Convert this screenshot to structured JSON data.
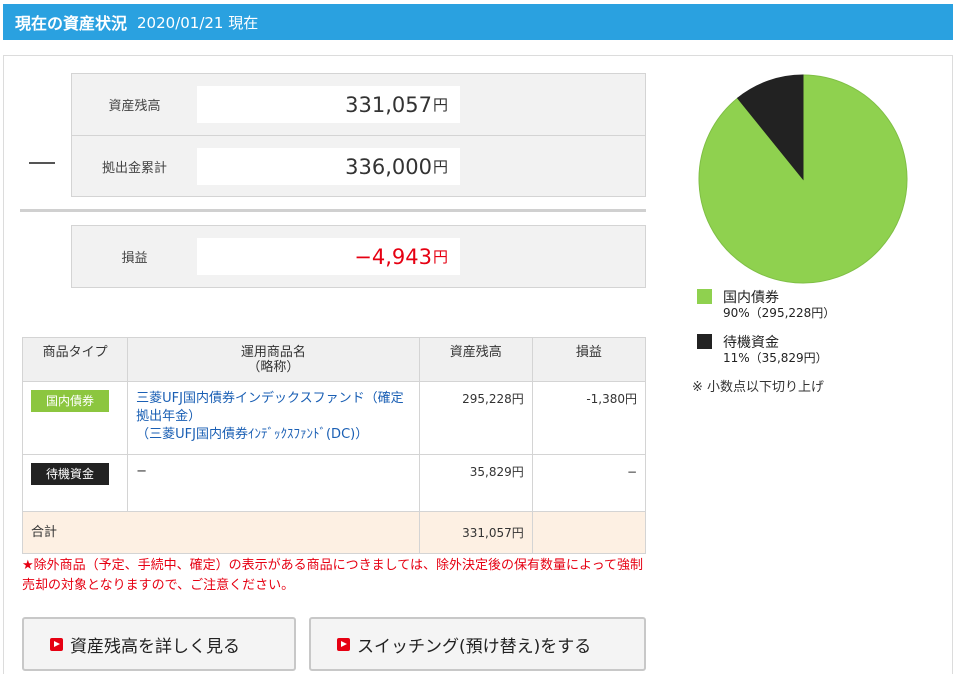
{
  "header": {
    "title": "現在の資産状況",
    "date": "2020/01/21 現在"
  },
  "summary": {
    "balance": {
      "label": "資産残高",
      "value": "331,057",
      "unit": "円"
    },
    "contributions": {
      "label": "拠出金累計",
      "value": "336,000",
      "unit": "円"
    },
    "profit": {
      "label": "損益",
      "value": "−4,943",
      "unit": "円"
    }
  },
  "table": {
    "headers": [
      "商品タイプ",
      "運用商品名\n（略称）",
      "資産残高",
      "損益"
    ],
    "rows": [
      {
        "type": "国内債券",
        "name": "三菱UFJ国内債券インデックスファンド（確定拠出年金）",
        "short": "（三菱UFJ国内債券ｲﾝﾃﾞｯｸｽﾌｧﾝﾄﾞ(DC)）",
        "balance": "295,228円",
        "profit": "-1,380円"
      },
      {
        "type": "待機資金",
        "name": "−",
        "balance": "35,829円",
        "profit": "−"
      }
    ],
    "total": {
      "label": "合計",
      "balance": "331,057円"
    }
  },
  "note": "★除外商品（予定、手続中、確定）の表示がある商品につきましては、除外決定後の保有数量によって強制売却の対象となりますので、ご注意ください。",
  "buttons": {
    "details": "資産残高を詳しく見る",
    "switching": "スイッチング(預け替え)をする"
  },
  "chart_data": {
    "type": "pie",
    "slices": [
      {
        "label": "国内債券",
        "percent_label": "90%（295,228円）",
        "value": 295228,
        "color": "#8fd14f"
      },
      {
        "label": "待機資金",
        "percent_label": "11%（35,829円）",
        "value": 35829,
        "color": "#222222"
      }
    ],
    "note": "※ 小数点以下切り上げ"
  }
}
